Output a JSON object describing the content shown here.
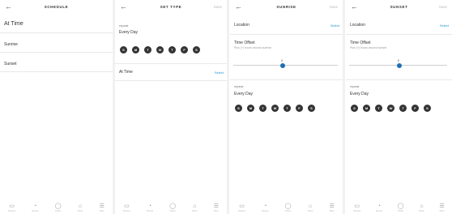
{
  "screens": {
    "schedule": {
      "back": "←",
      "title": "SCHEDULE",
      "options": [
        "At Time",
        "Sunrise",
        "Sunset"
      ]
    },
    "set_type": {
      "back": "←",
      "title": "SET TYPE",
      "save": "Save",
      "repeat_label": "repeat",
      "repeat_value": "Every Day",
      "days": [
        "S",
        "M",
        "T",
        "W",
        "T",
        "F",
        "S"
      ],
      "at_time_label": "At Time",
      "at_time_action": "Select"
    },
    "sunrise": {
      "back": "←",
      "title": "SUNRISE",
      "save": "Save",
      "location_label": "Location",
      "location_action": "Select",
      "time_offset_label": "Time Offset",
      "time_offset_subtext": "Plus (+) hours around sunrise",
      "offset_value": "0",
      "repeat_label": "repeat",
      "repeat_value": "Every Day",
      "days": [
        "S",
        "M",
        "T",
        "W",
        "T",
        "F",
        "S"
      ]
    },
    "sunset": {
      "back": "←",
      "title": "SUNSET",
      "save": "Save",
      "location_label": "Location",
      "location_action": "Select",
      "time_offset_label": "Time Offset",
      "time_offset_subtext": "Plus (+) hours around sunset",
      "offset_value": "0",
      "repeat_label": "repeat",
      "repeat_value": "Every Day",
      "days": [
        "S",
        "M",
        "T",
        "W",
        "T",
        "F",
        "S"
      ]
    }
  },
  "nav": {
    "items": [
      {
        "icon": "devices-icon",
        "label": "Devices"
      },
      {
        "icon": "scenes-icon",
        "label": "Scenes"
      },
      {
        "icon": "power-icon",
        "label": "Power"
      },
      {
        "icon": "home-icon",
        "label": "Home"
      },
      {
        "icon": "menu-icon",
        "label": "More"
      }
    ]
  },
  "colors": {
    "accent": "#1f8fd6",
    "day_circle": "#333333",
    "slider_thumb": "#1d6fb5"
  }
}
